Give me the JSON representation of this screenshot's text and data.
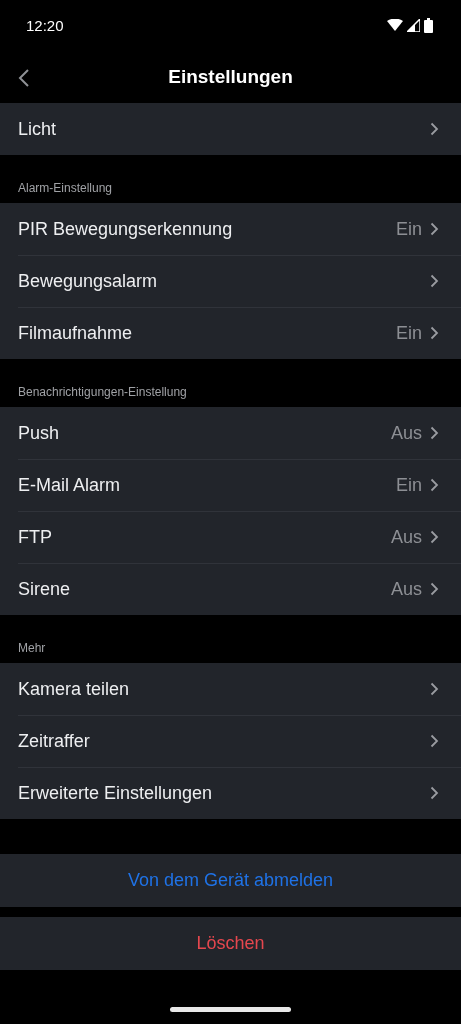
{
  "status_bar": {
    "time": "12:20"
  },
  "header": {
    "title": "Einstellungen"
  },
  "sections": [
    {
      "items": [
        {
          "label": "Licht"
        }
      ]
    },
    {
      "title": "Alarm-Einstellung",
      "items": [
        {
          "label": "PIR Bewegungserkennung",
          "value": "Ein"
        },
        {
          "label": "Bewegungsalarm"
        },
        {
          "label": "Filmaufnahme",
          "value": "Ein"
        }
      ]
    },
    {
      "title": "Benachrichtigungen-Einstellung",
      "items": [
        {
          "label": "Push",
          "value": "Aus"
        },
        {
          "label": "E-Mail Alarm",
          "value": "Ein"
        },
        {
          "label": "FTP",
          "value": "Aus"
        },
        {
          "label": "Sirene",
          "value": "Aus"
        }
      ]
    },
    {
      "title": "Mehr",
      "items": [
        {
          "label": "Kamera teilen"
        },
        {
          "label": "Zeitraffer"
        },
        {
          "label": "Erweiterte Einstellungen"
        }
      ]
    }
  ],
  "actions": [
    {
      "label": "Von dem Gerät abmelden",
      "kind": "primary"
    },
    {
      "label": "Löschen",
      "kind": "destructive"
    }
  ]
}
